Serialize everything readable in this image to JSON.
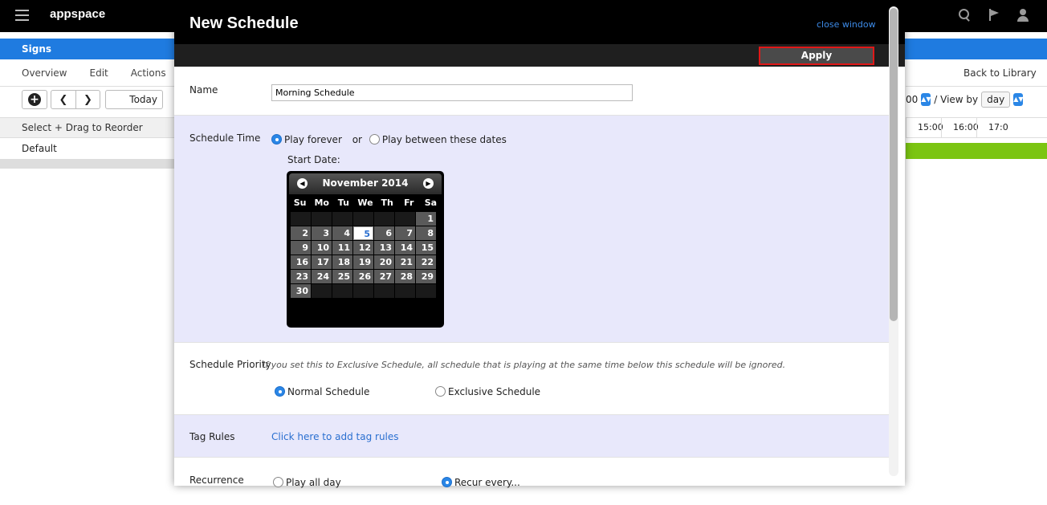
{
  "app": {
    "brand": "appspace",
    "section": "Signs",
    "tabs": [
      "Overview",
      "Edit",
      "Actions"
    ],
    "today_label": "Today",
    "reorder_label": "Select + Drag to Reorder",
    "default_item": "Default",
    "back_to_library": "Back to Library",
    "time_value": "00",
    "view_by_label": "/ View by",
    "view_by_value": "day",
    "hours": [
      "15:00",
      "16:00",
      "17:0"
    ]
  },
  "modal": {
    "title": "New Schedule",
    "close_label": "close window",
    "apply_label": "Apply",
    "name": {
      "label": "Name",
      "value": "Morning Schedule"
    },
    "schedule_time": {
      "label": "Schedule Time",
      "option_forever": "Play forever",
      "or_label": "or",
      "option_between": "Play between these dates",
      "start_date_label": "Start Date:"
    },
    "calendar": {
      "month": "November 2014",
      "weekdays": [
        "Su",
        "Mo",
        "Tu",
        "We",
        "Th",
        "Fr",
        "Sa"
      ],
      "first_weekday_index": 6,
      "days_in_month": 30,
      "today": 5
    },
    "priority": {
      "label": "Schedule Priority",
      "note": "If you set this to Exclusive Schedule, all schedule that is playing at the same time below this schedule will be ignored.",
      "option_normal": "Normal Schedule",
      "option_exclusive": "Exclusive Schedule"
    },
    "tag_rules": {
      "label": "Tag Rules",
      "link": "Click here to add tag rules"
    },
    "recurrence": {
      "label": "Recurrence",
      "option_all_day": "Play all day",
      "option_recur": "Recur every..."
    }
  }
}
